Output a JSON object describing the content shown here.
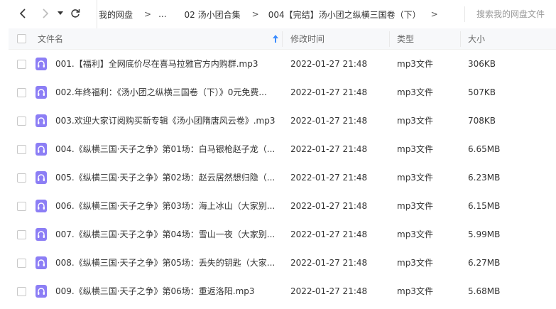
{
  "breadcrumb": {
    "root": "我的网盘",
    "sep": ">",
    "ellipsis": "...",
    "parent": "02 汤小团合集",
    "current": "004【完结】汤小团之纵横三国卷（下）"
  },
  "search": {
    "placeholder": "搜索我的网盘文件"
  },
  "columns": {
    "name": "文件名",
    "time": "修改时间",
    "type": "类型",
    "size": "大小"
  },
  "colors": {
    "accent": "#3b8cff",
    "icon_bg": "#8c7ef5"
  },
  "icons": {
    "back": "chevron-left-icon",
    "forward": "chevron-right-icon",
    "history": "caret-down-icon",
    "refresh": "refresh-icon",
    "sort": "arrow-up-icon",
    "audio": "headphones-icon"
  },
  "files": [
    {
      "name": "001.【福利】全网底价尽在喜马拉雅官方内购群.mp3",
      "time": "2022-01-27 21:48",
      "type": "mp3文件",
      "size": "306KB"
    },
    {
      "name": "002.年终福利：《汤小团之纵横三国卷（下）》0元免费...",
      "time": "2022-01-27 21:48",
      "type": "mp3文件",
      "size": "507KB"
    },
    {
      "name": "003.欢迎大家订阅购买新专辑《汤小团隋唐风云卷》.mp3",
      "time": "2022-01-27 21:48",
      "type": "mp3文件",
      "size": "708KB"
    },
    {
      "name": "004.《纵横三国·天子之争》第01场：白马银枪赵子龙（...",
      "time": "2022-01-27 21:48",
      "type": "mp3文件",
      "size": "6.65MB"
    },
    {
      "name": "005.《纵横三国·天子之争》第02场：赵云居然想归隐（...",
      "time": "2022-01-27 21:48",
      "type": "mp3文件",
      "size": "6.23MB"
    },
    {
      "name": "006.《纵横三国·天子之争》第03场：海上冰山（大家别...",
      "time": "2022-01-27 21:48",
      "type": "mp3文件",
      "size": "6.15MB"
    },
    {
      "name": "007.《纵横三国·天子之争》第04场：雪山一夜（大家别...",
      "time": "2022-01-27 21:48",
      "type": "mp3文件",
      "size": "5.99MB"
    },
    {
      "name": "008.《纵横三国·天子之争》第05场：丢失的钥匙（大家...",
      "time": "2022-01-27 21:48",
      "type": "mp3文件",
      "size": "6.27MB"
    },
    {
      "name": "009.《纵横三国·天子之争》第06场：重返洛阳.mp3",
      "time": "2022-01-27 21:48",
      "type": "mp3文件",
      "size": "5.68MB"
    }
  ]
}
